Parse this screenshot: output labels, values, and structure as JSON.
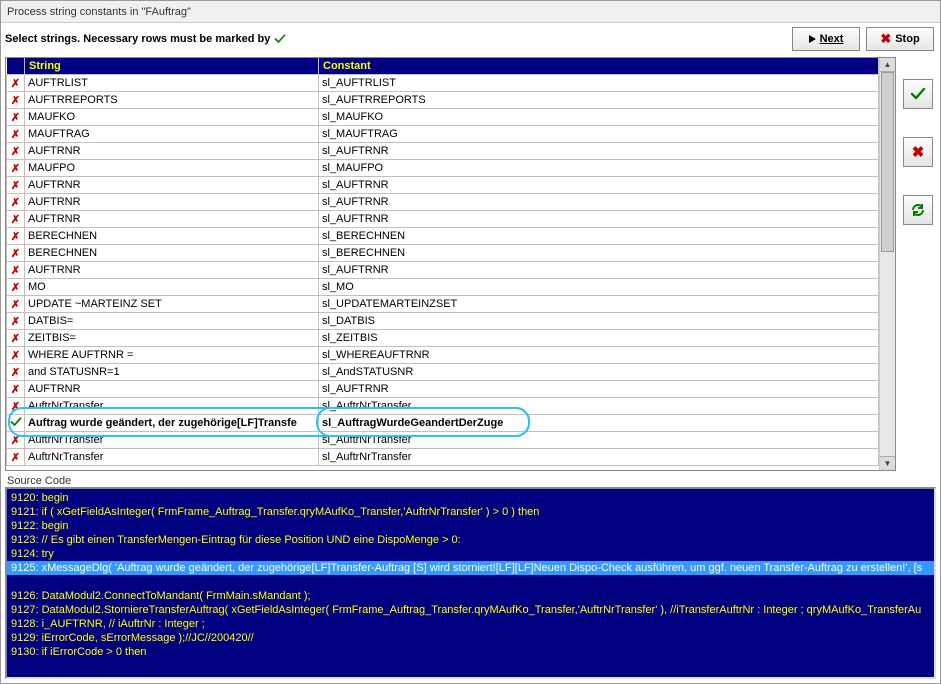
{
  "window": {
    "title": "Process string constants in \"FAuftrag\""
  },
  "toolbar": {
    "instruction": "Select strings. Necessary rows must be marked by",
    "next_label": "Next",
    "stop_label": "Stop"
  },
  "grid": {
    "headers": {
      "string": "String",
      "constant": "Constant"
    },
    "rows": [
      {
        "mark": "x",
        "string": "AUFTRLIST",
        "constant": "sl_AUFTRLIST"
      },
      {
        "mark": "x",
        "string": "AUFTRREPORTS",
        "constant": "sl_AUFTRREPORTS"
      },
      {
        "mark": "x",
        "string": "MAUFKO",
        "constant": "sl_MAUFKO"
      },
      {
        "mark": "x",
        "string": "MAUFTRAG",
        "constant": "sl_MAUFTRAG"
      },
      {
        "mark": "x",
        "string": "AUFTRNR",
        "constant": "sl_AUFTRNR"
      },
      {
        "mark": "x",
        "string": "MAUFPO",
        "constant": "sl_MAUFPO"
      },
      {
        "mark": "x",
        "string": "AUFTRNR",
        "constant": "sl_AUFTRNR"
      },
      {
        "mark": "x",
        "string": "AUFTRNR",
        "constant": "sl_AUFTRNR"
      },
      {
        "mark": "x",
        "string": "AUFTRNR",
        "constant": "sl_AUFTRNR"
      },
      {
        "mark": "x",
        "string": "BERECHNEN",
        "constant": "sl_BERECHNEN"
      },
      {
        "mark": "x",
        "string": "BERECHNEN",
        "constant": "sl_BERECHNEN"
      },
      {
        "mark": "x",
        "string": "AUFTRNR",
        "constant": "sl_AUFTRNR"
      },
      {
        "mark": "x",
        "string": "MO",
        "constant": "sl_MO"
      },
      {
        "mark": "x",
        "string": "UPDATE ~MARTEINZ SET ",
        "constant": "sl_UPDATEMARTEINZSET"
      },
      {
        "mark": "x",
        "string": "DATBIS=",
        "constant": "sl_DATBIS"
      },
      {
        "mark": "x",
        "string": "ZEITBIS=",
        "constant": "sl_ZEITBIS"
      },
      {
        "mark": "x",
        "string": " WHERE AUFTRNR = ",
        "constant": "sl_WHEREAUFTRNR"
      },
      {
        "mark": "x",
        "string": " and STATUSNR=1",
        "constant": "sl_AndSTATUSNR"
      },
      {
        "mark": "x",
        "string": "AUFTRNR",
        "constant": "sl_AUFTRNR"
      },
      {
        "mark": "x",
        "string": "AuftrNrTransfer",
        "constant": "sl_AuftrNrTransfer"
      },
      {
        "mark": "v",
        "string": "Auftrag wurde geändert, der zugehörige[LF]Transfe",
        "constant": "sl_AuftragWurdeGeandertDerZuge",
        "selected": true
      },
      {
        "mark": "x",
        "string": "AuftrNrTransfer",
        "constant": "sl_AuftrNrTransfer"
      },
      {
        "mark": "x",
        "string": "AuftrNrTransfer",
        "constant": "sl_AuftrNrTransfer"
      }
    ]
  },
  "side": {
    "accept_icon": "check-icon",
    "reject_icon": "x-icon",
    "refresh_icon": "refresh-icon"
  },
  "source": {
    "label": "Source Code",
    "lines": [
      {
        "n": "9120",
        "t": "begin"
      },
      {
        "n": "9121",
        "t": "if  ( xGetFieldAsInteger( FrmFrame_Auftrag_Transfer.qryMAufKo_Transfer,'AuftrNrTransfer' ) > 0 ) then"
      },
      {
        "n": "9122",
        "t": "begin"
      },
      {
        "n": "9123",
        "t": "// Es gibt einen TransferMengen-Eintrag für diese Position UND eine DispoMenge > 0:"
      },
      {
        "n": "9124",
        "t": "try"
      },
      {
        "n": "9125",
        "t": "xMessageDlg( 'Auftrag wurde geändert, der zugehörige[LF]Transfer-Auftrag [S] wird storniert![LF][LF]Neuen Dispo-Check ausführen, um ggf. neuen Transfer-Auftrag zu erstellen!', [s",
        "sel": true
      },
      {
        "n": "9126",
        "t": "DataModul2.ConnectToMandant( FrmMain.sMandant );"
      },
      {
        "n": "9127",
        "t": "DataModul2.StorniereTransferAuftrag( xGetFieldAsInteger( FrmFrame_Auftrag_Transfer.qryMAufKo_Transfer,'AuftrNrTransfer' ), //iTransferAuftrNr : Integer ; qryMAufKo_TransferAu"
      },
      {
        "n": "9128",
        "t": "i_AUFTRNR, // iAuftrNr : Integer ;"
      },
      {
        "n": "9129",
        "t": "iErrorCode, sErrorMessage );//JC//200420//"
      },
      {
        "n": "9130",
        "t": "if iErrorCode > 0 then"
      }
    ]
  }
}
